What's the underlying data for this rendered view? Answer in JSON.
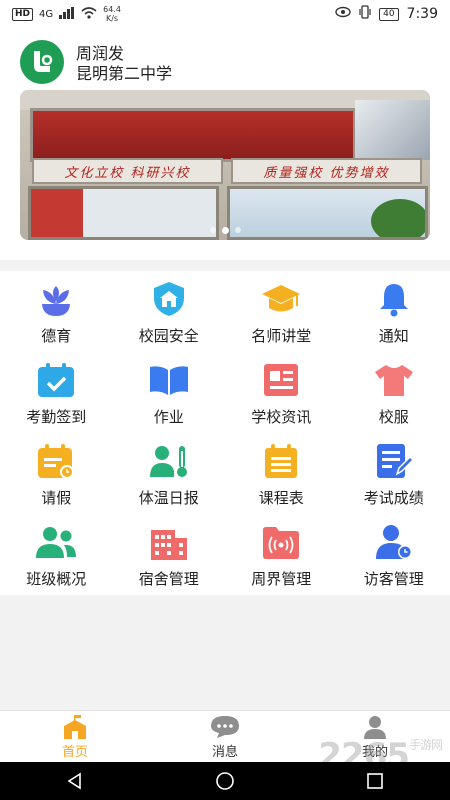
{
  "status_bar": {
    "hd": "HD",
    "signal": "4G",
    "speed_value": "64.4",
    "speed_unit": "K/s",
    "battery": "40",
    "time": "7:39"
  },
  "profile": {
    "name": "周润发",
    "school": "昆明第二中学"
  },
  "banner": {
    "sign_left": "文化立校 科研兴校",
    "sign_right": "质量强校 优势增效",
    "slides": 3,
    "active_slide": 1
  },
  "menu": [
    {
      "label": "德育",
      "icon": "flower-icon",
      "color": "#5b6ee8"
    },
    {
      "label": "校园安全",
      "icon": "shield-icon",
      "color": "#2fb0e6"
    },
    {
      "label": "名师讲堂",
      "icon": "graduation-cap-icon",
      "color": "#f5b021"
    },
    {
      "label": "通知",
      "icon": "bell-icon",
      "color": "#3b7bf0"
    },
    {
      "label": "考勤签到",
      "icon": "calendar-check-icon",
      "color": "#2fa8e8"
    },
    {
      "label": "作业",
      "icon": "book-icon",
      "color": "#3b7bf0"
    },
    {
      "label": "学校资讯",
      "icon": "news-icon",
      "color": "#f06a6a"
    },
    {
      "label": "校服",
      "icon": "shirt-icon",
      "color": "#f47a7a"
    },
    {
      "label": "请假",
      "icon": "leave-calendar-icon",
      "color": "#f5b021"
    },
    {
      "label": "体温日报",
      "icon": "thermometer-user-icon",
      "color": "#27b07a"
    },
    {
      "label": "课程表",
      "icon": "schedule-icon",
      "color": "#f5b021"
    },
    {
      "label": "考试成绩",
      "icon": "exam-edit-icon",
      "color": "#3b6ee8"
    },
    {
      "label": "班级概况",
      "icon": "group-icon",
      "color": "#27b07a"
    },
    {
      "label": "宿舍管理",
      "icon": "building-icon",
      "color": "#f06a6a"
    },
    {
      "label": "周界管理",
      "icon": "broadcast-folder-icon",
      "color": "#f06a6a"
    },
    {
      "label": "访客管理",
      "icon": "visitor-icon",
      "color": "#3b6ee8"
    }
  ],
  "bottom_nav": [
    {
      "label": "首页",
      "icon": "school-home-icon",
      "active": true
    },
    {
      "label": "消息",
      "icon": "chat-bubble-icon",
      "active": false
    },
    {
      "label": "我的",
      "icon": "profile-icon",
      "active": false
    }
  ],
  "watermark": {
    "text": "2265",
    "suffix": "手游网"
  }
}
